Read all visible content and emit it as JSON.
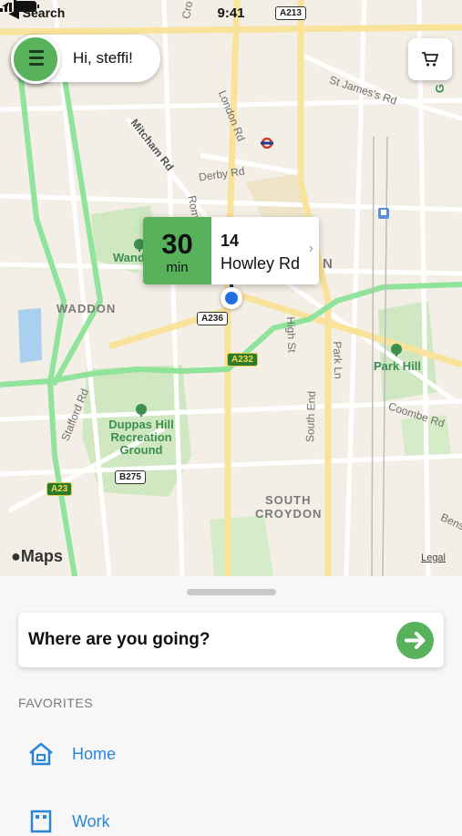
{
  "status_bar": {
    "back_label": "◀ Search",
    "time": "9:41"
  },
  "header": {
    "greeting": "Hi, steffi!"
  },
  "map": {
    "roads": [
      "Mitcham Rd",
      "London Rd",
      "Derby Rd",
      "St James's Rd",
      "Stafford Rd",
      "High St",
      "South End",
      "Park Ln",
      "Coombe Rd",
      "Benst",
      "Rom",
      "Cro"
    ],
    "places": [
      "WADDON",
      "SOUTH",
      "CROYDON",
      "N"
    ],
    "parks": [
      "Wand",
      "Duppas Hill Recreation Ground",
      "Park Hill",
      "G"
    ],
    "shields": [
      "A213",
      "A236",
      "A232",
      "B275",
      "A23"
    ],
    "attribution": "Maps",
    "legal": "Legal"
  },
  "trip_card": {
    "minutes": "30",
    "unit": "min",
    "address_line1": "14",
    "address_line2": "Howley Rd"
  },
  "bottom_sheet": {
    "search_prompt": "Where are you going?",
    "favorites_heading": "FAVORITES",
    "favorites": [
      {
        "label": "Home",
        "icon": "house-icon"
      },
      {
        "label": "Work",
        "icon": "building-icon"
      }
    ]
  },
  "colors": {
    "accent_green": "#58b25c",
    "link_blue": "#2a86d6",
    "location_blue": "#1f6fe0",
    "route_green": "#8fe39a"
  }
}
